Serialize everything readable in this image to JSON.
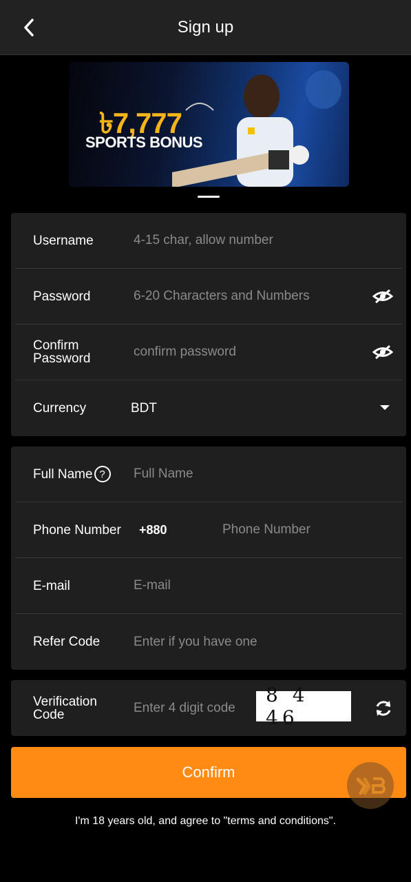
{
  "header": {
    "title": "Sign up"
  },
  "banner": {
    "amount": "৳7,777",
    "subtitle": "SPORTS BONUS"
  },
  "account_section": {
    "username": {
      "label": "Username",
      "placeholder": "4-15 char, allow number"
    },
    "password": {
      "label": "Password",
      "placeholder": "6-20 Characters and Numbers"
    },
    "confirm_password": {
      "label": "Confirm Password",
      "placeholder": "confirm password"
    },
    "currency": {
      "label": "Currency",
      "value": "BDT"
    }
  },
  "profile_section": {
    "full_name": {
      "label": "Full Name",
      "help": "?",
      "placeholder": "Full Name"
    },
    "phone": {
      "label": "Phone Number",
      "prefix": "+880",
      "placeholder": "Phone Number"
    },
    "email": {
      "label": "E-mail",
      "placeholder": "E-mail"
    },
    "refer_code": {
      "label": "Refer Code",
      "placeholder": "Enter if you have one"
    }
  },
  "verification": {
    "label": "Verification Code",
    "placeholder": "Enter 4 digit code",
    "captcha": "8 4 46"
  },
  "confirm_button": "Confirm",
  "terms_text": "I'm 18 years old, and agree to \"terms and conditions\".",
  "colors": {
    "accent": "#ff8a14",
    "background": "#000000",
    "card": "#1f1f1f",
    "header": "#222222"
  }
}
